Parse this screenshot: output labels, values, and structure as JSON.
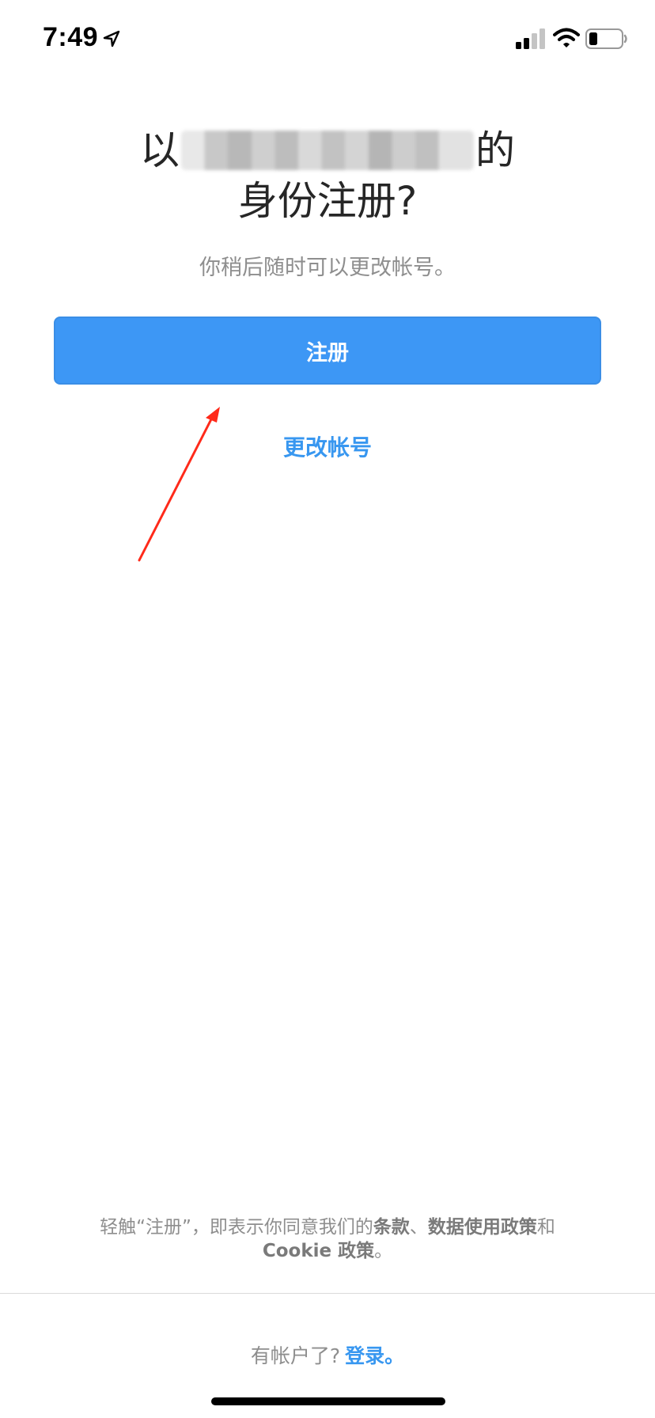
{
  "status_bar": {
    "time": "7:49",
    "icons": [
      "location-arrow-icon",
      "cellular-signal-icon",
      "wifi-icon",
      "battery-icon"
    ]
  },
  "title": {
    "prefix": "以",
    "suffix": "的",
    "line2": "身份注册?"
  },
  "subtitle": "你稍后随时可以更改帐号。",
  "signup_button": {
    "label": "注册",
    "color": "#3d97f5"
  },
  "change_account_link": "更改帐号",
  "annotation": {
    "color": "#ff2a1a"
  },
  "terms": {
    "part1": "轻触“注册”，即表示你同意我们的",
    "terms_link": "条款",
    "separator": "、",
    "data_policy_link": "数据使用政策",
    "and": "和",
    "cookie_policy_link": "Cookie 政策",
    "end": "。"
  },
  "login": {
    "prompt": "有帐户了?",
    "link": "登录。"
  },
  "colors": {
    "link": "#3897f0",
    "secondary_text": "#8e8e8e",
    "divider": "#dbdbdb"
  }
}
